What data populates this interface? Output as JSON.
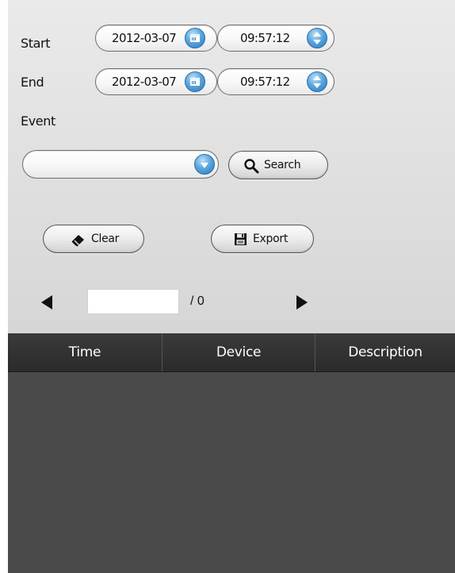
{
  "filters": {
    "start_label": "Start",
    "end_label": "End",
    "event_label": "Event",
    "start_date": "2012-03-07",
    "start_time": "09:57:12",
    "end_date": "2012-03-07",
    "end_time": "09:57:12",
    "event_value": ""
  },
  "actions": {
    "search_label": "Search",
    "clear_label": "Clear",
    "export_label": "Export"
  },
  "pagination": {
    "current_page": "",
    "total_label": "/ 0"
  },
  "table": {
    "columns": [
      "Time",
      "Device",
      "Description"
    ],
    "rows": []
  },
  "colors": {
    "accent": "#3b8fd4",
    "table_bg": "#4a4a4a",
    "header_bg": "#2f2f2f"
  },
  "icons": {
    "calendar": "calendar-icon",
    "spinner": "spinner-updown-icon",
    "dropdown": "chevron-down-icon",
    "search": "magnifier-icon",
    "clear": "eraser-icon",
    "export": "floppy-disk-icon",
    "prev": "triangle-left-icon",
    "next": "triangle-right-icon"
  }
}
